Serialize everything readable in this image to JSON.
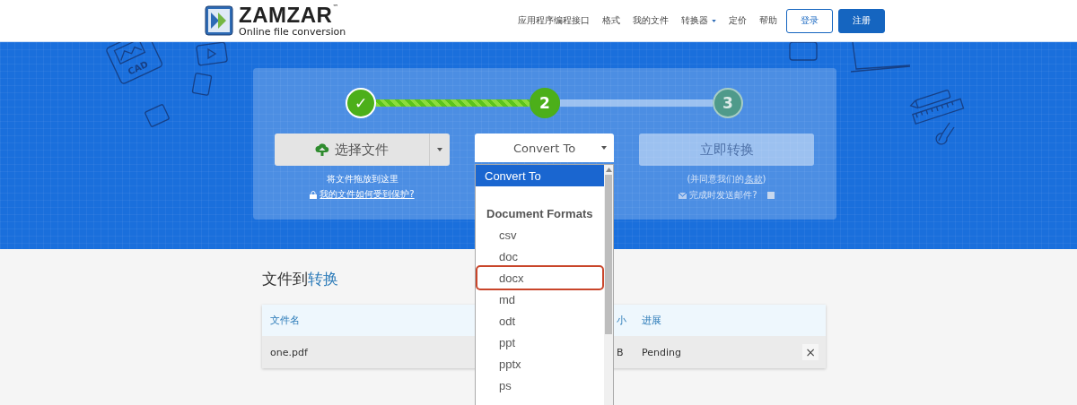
{
  "header": {
    "logo": {
      "name": "ZAMZAR",
      "trademark": "™",
      "tagline": "Online file conversion"
    },
    "nav": [
      {
        "label": "应用程序编程接口",
        "has_menu": false
      },
      {
        "label": "格式",
        "has_menu": false
      },
      {
        "label": "我的文件",
        "has_menu": false
      },
      {
        "label": "转换器",
        "has_menu": true
      },
      {
        "label": "定价",
        "has_menu": false
      },
      {
        "label": "帮助",
        "has_menu": false
      }
    ],
    "buttons": [
      {
        "label": "登录",
        "kind": "outline"
      },
      {
        "label": "注册",
        "kind": "primary"
      }
    ]
  },
  "hero": {
    "doodle_label": "CAD",
    "steps": [
      {
        "label": "✓",
        "completed": true,
        "current": false
      },
      {
        "label": "2",
        "completed": false,
        "current": true
      },
      {
        "label": "3",
        "completed": false,
        "current": false
      }
    ],
    "connectors": [
      {
        "filled": true
      },
      {
        "filled": false
      }
    ],
    "choose_file": {
      "label": "选择文件",
      "hint": "将文件拖放到这里",
      "link": "我的文件如何受到保护?"
    },
    "convert_select": {
      "value": "Convert To"
    },
    "convert_button": {
      "label": "立即转换",
      "disabled": true,
      "terms_prefix": "(并同意我们的",
      "terms_link": "条款",
      "terms_suffix": ")",
      "email_label": "完成时发送邮件?",
      "email_checked": false
    }
  },
  "dropdown": {
    "items": [
      {
        "kind": "option",
        "label": "Convert To",
        "selected": true,
        "highlighted": false
      },
      {
        "kind": "spacer"
      },
      {
        "kind": "group",
        "label": "Document Formats"
      },
      {
        "kind": "option",
        "label": "csv",
        "selected": false,
        "highlighted": false
      },
      {
        "kind": "option",
        "label": "doc",
        "selected": false,
        "highlighted": false
      },
      {
        "kind": "option",
        "label": "docx",
        "selected": false,
        "highlighted": true
      },
      {
        "kind": "option",
        "label": "md",
        "selected": false,
        "highlighted": false
      },
      {
        "kind": "option",
        "label": "odt",
        "selected": false,
        "highlighted": false
      },
      {
        "kind": "option",
        "label": "ppt",
        "selected": false,
        "highlighted": false
      },
      {
        "kind": "option",
        "label": "pptx",
        "selected": false,
        "highlighted": false
      },
      {
        "kind": "option",
        "label": "ps",
        "selected": false,
        "highlighted": false
      }
    ]
  },
  "files": {
    "title_prefix": "文件到",
    "title_accent": "转换",
    "columns": [
      "文件名",
      "小",
      "进展"
    ],
    "rows": [
      {
        "name": "one.pdf",
        "size": "B",
        "status": "Pending",
        "remove": "×"
      }
    ]
  }
}
